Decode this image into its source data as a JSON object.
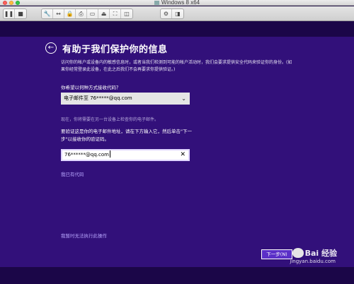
{
  "window": {
    "title": "Windows 8 x64"
  },
  "page": {
    "title": "有助于我们保护你的信息",
    "intro": "访问你的帐户或设备内的敏感信息时，或者当我们检测到可能的帐户活动时，我们会要求提供安全代码来验证你的身份。(如果你经常登录此设备，在此之后我们不会再要求你提供验证。)",
    "method_label": "你希望以何种方式接收代码？",
    "method_value": "电子邮件至 76*****@qq.com",
    "hint": "现在，你将需要在另一台设备上检查你的电子邮件。",
    "verify_text": "要验证这是你的电子邮件地址，请在下方输入它，然后单击\"下一步\"以接收你的验证码。",
    "email_value": "76******@qq.com",
    "have_code_link": "我已有代码",
    "cannot_do_link": "我暂时无法执行此操作",
    "next_button": "下一步(N)"
  },
  "watermark": {
    "brand": "Bai 经验",
    "url": "jingyan.baidu.com"
  }
}
